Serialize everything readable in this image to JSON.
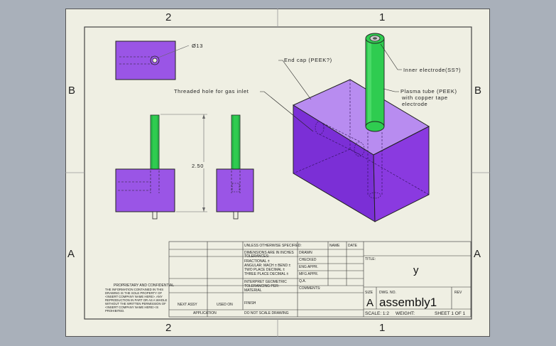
{
  "zones": {
    "top_left": "2",
    "top_right": "1",
    "bottom_left": "2",
    "bottom_right": "1",
    "left_upper": "B",
    "left_lower": "A",
    "right_upper": "B",
    "right_lower": "A"
  },
  "annotations": {
    "diameter": "Ø13",
    "dimension_height": "2.50",
    "end_cap": "End cap (PEEK?)",
    "threaded_hole": "Threaded hole for gas inlet",
    "inner_electrode": "Inner electrode(SS?)",
    "plasma_tube_1": "Plasma tube (PEEK)",
    "plasma_tube_2": "with copper tape",
    "plasma_tube_3": "electrode"
  },
  "title_block": {
    "unless_specified": "UNLESS OTHERWISE SPECIFIED:",
    "dimensions": "DIMENSIONS ARE IN INCHES",
    "tolerances": "TOLERANCES:",
    "fractional": "FRACTIONAL ±",
    "angular": "ANGULAR: MACH ± BEND ±",
    "two_place": "TWO PLACE DECIMAL ±",
    "three_place": "THREE PLACE DECIMAL ±",
    "interpret": "INTERPRET GEOMETRIC",
    "tolerancing": "TOLERANCING PER:",
    "material": "MATERIAL",
    "finish": "FINISH",
    "do_not_scale": "DO NOT SCALE DRAWING",
    "name": "NAME",
    "date": "DATE",
    "drawn": "DRAWN",
    "checked": "CHECKED",
    "eng_appr": "ENG APPR.",
    "mfg_appr": "MFG APPR.",
    "qa": "Q.A.",
    "comments": "COMMENTS:",
    "next_assy": "NEXT ASSY",
    "used_on": "USED ON",
    "application": "APPLICATION",
    "proprietary": "PROPRIETARY AND CONFIDENTIAL",
    "prop_body": "THE INFORMATION CONTAINED IN THIS DRAWING IS THE SOLE PROPERTY OF <INSERT COMPANY NAME HERE>. ANY REPRODUCTION IN PART OR AS A WHOLE WITHOUT THE WRITTEN PERMISSION OF <INSERT COMPANY NAME HERE> IS PROHIBITED.",
    "title_label": "TITLE:",
    "title_value": "y",
    "size_label": "SIZE",
    "dwg_no_label": "DWG. NO.",
    "rev_label": "REV",
    "size_value": "A",
    "dwg_no": "assembly1",
    "scale": "SCALE: 1:2",
    "weight": "WEIGHT:",
    "sheet": "SHEET 1 OF 1"
  },
  "colors": {
    "purple": "#9a55e6",
    "green": "#2fcc50",
    "sheet": "#efefe3",
    "background": "#a9b0ba"
  }
}
